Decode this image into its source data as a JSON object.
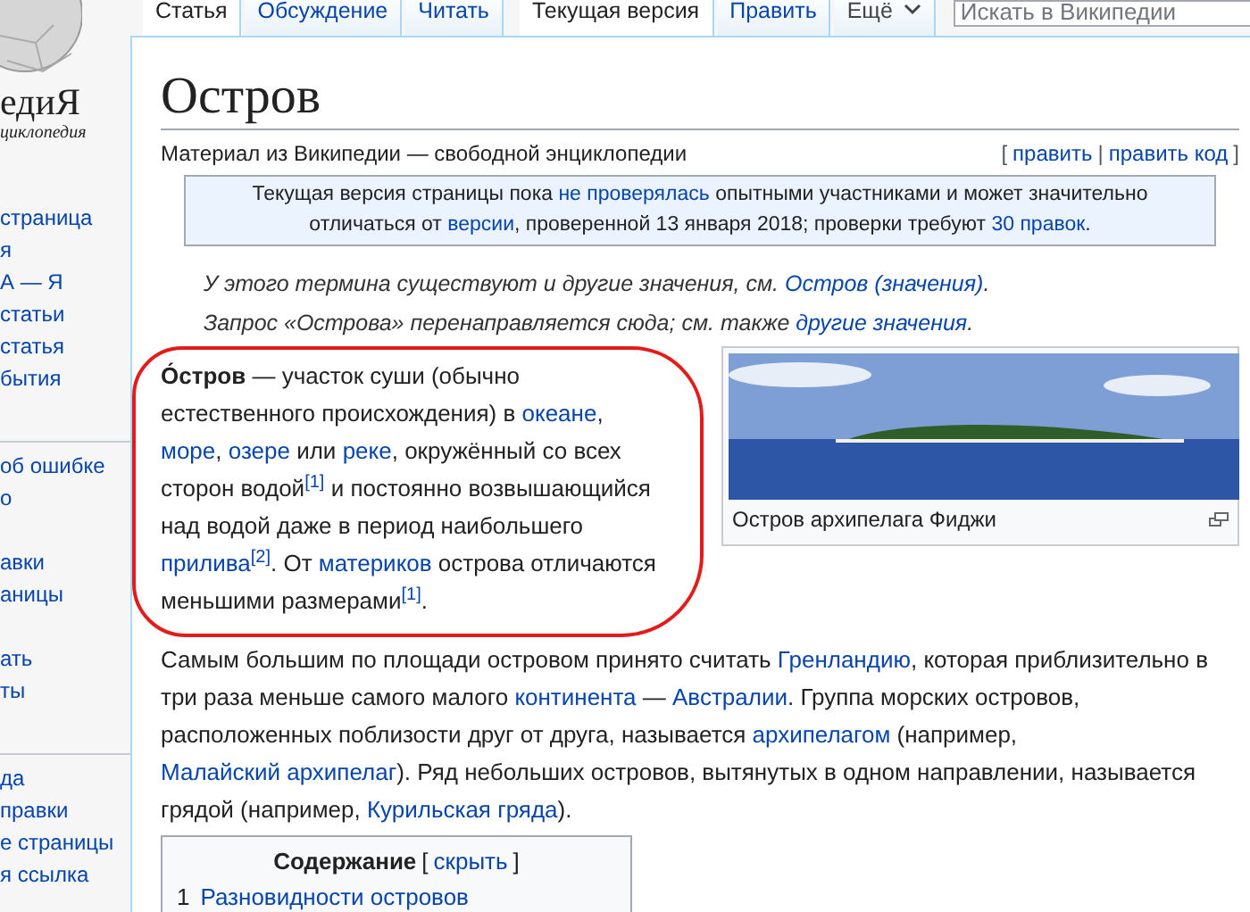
{
  "logo": {
    "wordmark": "едиЯ",
    "tagline": "циклопедия"
  },
  "sidebar": {
    "groups": [
      [
        "страница",
        "я",
        "А — Я",
        "статьи",
        "статья",
        "бытия"
      ],
      [
        "об ошибке",
        "о",
        "авки",
        "аницы",
        "ать",
        "ты"
      ],
      [
        "да",
        "правки",
        "е страницы",
        "я ссылка"
      ]
    ]
  },
  "tabs": [
    {
      "label": "Статья",
      "selected": true,
      "kind": "tab"
    },
    {
      "label": "Обсуждение",
      "selected": false,
      "kind": "tab"
    },
    {
      "label": "Читать",
      "selected": false,
      "kind": "tab"
    },
    {
      "label": "Текущая версия",
      "selected": true,
      "kind": "tab"
    },
    {
      "label": "Править",
      "selected": false,
      "kind": "tab"
    },
    {
      "label": "Ещё",
      "selected": false,
      "kind": "menu"
    }
  ],
  "search": {
    "placeholder": "Искать в Википедии"
  },
  "title": "Остров",
  "subtitle": "Материал из Википедии — свободной энциклопедии",
  "edit_links": {
    "open": "[",
    "links": [
      "править",
      "править код"
    ],
    "separator": "|",
    "close": "]"
  },
  "notice": [
    {
      "kind": "text",
      "text": "Текущая версия страницы пока "
    },
    {
      "kind": "link",
      "text": "не проверялась"
    },
    {
      "kind": "text",
      "text": " опытными участниками и может значительно отличаться от "
    },
    {
      "kind": "link",
      "text": "версии"
    },
    {
      "kind": "text",
      "text": ", проверенной 13 января 2018; проверки требуют "
    },
    {
      "kind": "link",
      "text": "30 правок"
    },
    {
      "kind": "text",
      "text": "."
    }
  ],
  "hatnotes": [
    [
      {
        "kind": "text",
        "text": "У этого термина существуют и другие значения, см. "
      },
      {
        "kind": "link",
        "text": "Остров (значения)"
      },
      {
        "kind": "text",
        "text": "."
      }
    ],
    [
      {
        "kind": "text",
        "text": "Запрос «Острова» перенаправляется сюда; см. также "
      },
      {
        "kind": "link",
        "text": "другие значения"
      },
      {
        "kind": "text",
        "text": "."
      }
    ]
  ],
  "lead": [
    {
      "kind": "bold",
      "text": "О́стров"
    },
    {
      "kind": "text",
      "text": " — участок суши (обычно естественного происхождения) в "
    },
    {
      "kind": "link",
      "text": "океане"
    },
    {
      "kind": "text",
      "text": ", "
    },
    {
      "kind": "link",
      "text": "море"
    },
    {
      "kind": "text",
      "text": ", "
    },
    {
      "kind": "link",
      "text": "озере"
    },
    {
      "kind": "text",
      "text": " или "
    },
    {
      "kind": "link",
      "text": "реке"
    },
    {
      "kind": "text",
      "text": ", окружённый со всех сторон водой"
    },
    {
      "kind": "ref",
      "text": "[1]"
    },
    {
      "kind": "text",
      "text": " и постоянно возвышающийся над водой даже в период наибольшего "
    },
    {
      "kind": "link",
      "text": "прилива"
    },
    {
      "kind": "ref",
      "text": "[2]"
    },
    {
      "kind": "text",
      "text": ". От "
    },
    {
      "kind": "link",
      "text": "материков"
    },
    {
      "kind": "text",
      "text": " острова отличаются меньшими размерами"
    },
    {
      "kind": "ref",
      "text": "[1]"
    },
    {
      "kind": "text",
      "text": "."
    }
  ],
  "figure": {
    "caption": "Остров архипелага Фиджи"
  },
  "body": [
    {
      "kind": "text",
      "text": "Самым большим по площади островом принято считать "
    },
    {
      "kind": "link",
      "text": "Гренландию"
    },
    {
      "kind": "text",
      "text": ", которая приблизительно в три раза меньше самого малого "
    },
    {
      "kind": "link",
      "text": "континента"
    },
    {
      "kind": "text",
      "text": " — "
    },
    {
      "kind": "link",
      "text": "Австралии"
    },
    {
      "kind": "text",
      "text": ". Группа морских островов, расположенных поблизости друг от друга, называется "
    },
    {
      "kind": "link",
      "text": "архипелагом"
    },
    {
      "kind": "text",
      "text": " (например, "
    },
    {
      "kind": "link",
      "text": "Малайский архипелаг"
    },
    {
      "kind": "text",
      "text": "). Ряд небольших островов, вытянутых в одном направлении, называется грядой (например, "
    },
    {
      "kind": "link",
      "text": "Курильская гряда"
    },
    {
      "kind": "text",
      "text": ")."
    }
  ],
  "toc": {
    "title": "Содержание",
    "open": "[",
    "toggle": "скрыть",
    "close": "]",
    "items": [
      {
        "number": "1",
        "label": "Разновидности островов"
      }
    ]
  }
}
